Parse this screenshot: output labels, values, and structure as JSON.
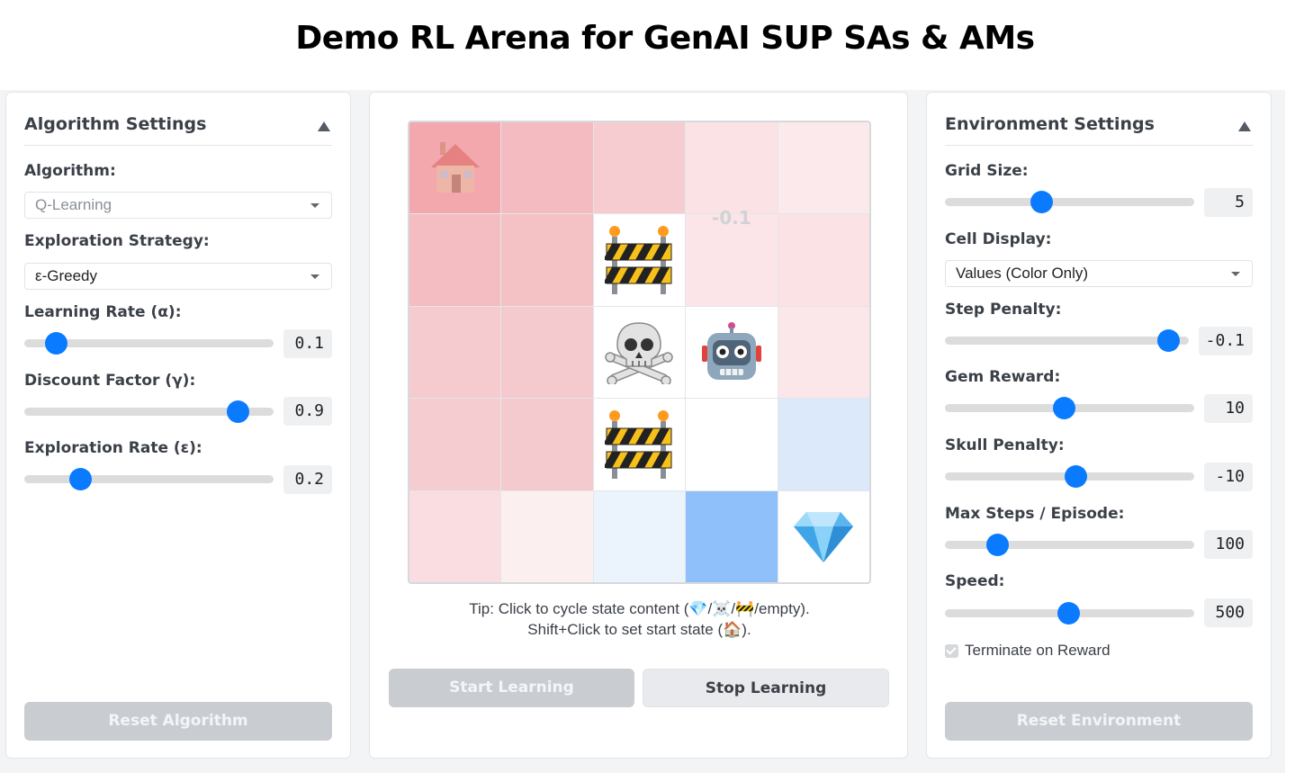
{
  "page": {
    "title": "Demo RL Arena for GenAI SUP SAs & AMs"
  },
  "algorithm_panel": {
    "title": "Algorithm Settings",
    "algorithm_label": "Algorithm:",
    "algorithm_value": "Q-Learning",
    "strategy_label": "Exploration Strategy:",
    "strategy_value": "ε-Greedy",
    "learning_rate_label": "Learning Rate (α):",
    "learning_rate_value": "0.1",
    "learning_rate_level": 0.125,
    "discount_label": "Discount Factor (γ):",
    "discount_value": "0.9",
    "discount_level": 0.855,
    "exploration_label": "Exploration Rate (ε):",
    "exploration_value": "0.2",
    "exploration_level": 0.225,
    "reset_label": "Reset Algorithm"
  },
  "arena": {
    "cell_value_text": "-0.1",
    "grid": [
      [
        {
          "bg": "#f2a8ad",
          "icon": "house-icon",
          "faded": true
        },
        {
          "bg": "#f4bcc0"
        },
        {
          "bg": "#f6ccd0"
        },
        {
          "bg": "#fae2e5"
        },
        {
          "bg": "#fbe9eb"
        }
      ],
      [
        {
          "bg": "#f3bdc1"
        },
        {
          "bg": "#f4c1c5"
        },
        {
          "bg": "#ffffff",
          "icon": "barrier-icon"
        },
        {
          "bg": "#fbe5e8",
          "value": true
        },
        {
          "bg": "#fae2e5"
        }
      ],
      [
        {
          "bg": "#f5cbcf"
        },
        {
          "bg": "#f5cacf"
        },
        {
          "bg": "#ffffff",
          "icon": "skull-icon"
        },
        {
          "bg": "#ffffff",
          "icon": "robot-icon"
        },
        {
          "bg": "#fbe6e9"
        }
      ],
      [
        {
          "bg": "#f5cdd1"
        },
        {
          "bg": "#f5cacf"
        },
        {
          "bg": "#ffffff",
          "icon": "barrier-icon"
        },
        {
          "bg": "#ffffff"
        },
        {
          "bg": "#dbe9fb"
        }
      ],
      [
        {
          "bg": "#f9dde0"
        },
        {
          "bg": "#fbeff0"
        },
        {
          "bg": "#ebf3fd"
        },
        {
          "bg": "#90c0fa"
        },
        {
          "bg": "#ffffff",
          "icon": "gem-icon"
        }
      ]
    ],
    "tip_line1": "Tip: Click to cycle state content (💎/☠️/🚧/empty).",
    "tip_line2": "Shift+Click to set start state (🏠).",
    "start_label": "Start Learning",
    "stop_label": "Stop Learning"
  },
  "environment_panel": {
    "title": "Environment Settings",
    "grid_size_label": "Grid Size:",
    "grid_size_value": "5",
    "grid_size_level": 0.385,
    "cell_display_label": "Cell Display:",
    "cell_display_value": "Values (Color Only)",
    "step_penalty_label": "Step Penalty:",
    "step_penalty_value": "-0.1",
    "step_penalty_level": 0.915,
    "gem_reward_label": "Gem Reward:",
    "gem_reward_value": "10",
    "gem_reward_level": 0.475,
    "skull_penalty_label": "Skull Penalty:",
    "skull_penalty_value": "-10",
    "skull_penalty_level": 0.525,
    "max_steps_label": "Max Steps / Episode:",
    "max_steps_value": "100",
    "max_steps_level": 0.21,
    "speed_label": "Speed:",
    "speed_value": "500",
    "speed_level": 0.495,
    "terminate_label": "Terminate on Reward",
    "terminate_checked": true,
    "reset_label": "Reset Environment"
  }
}
